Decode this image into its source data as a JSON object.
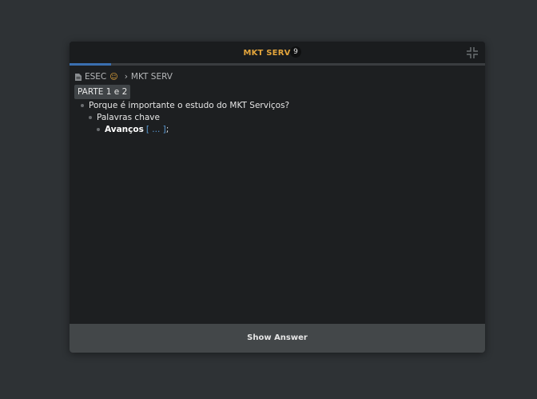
{
  "window": {
    "title": "MKT SERV",
    "count": "9",
    "progress": 0.1
  },
  "breadcrumb": {
    "root": "ESEC",
    "separator": "›",
    "current": "MKT SERV"
  },
  "tag": "PARTE 1 e 2",
  "outline": {
    "question": "Porque é importante o estudo do MKT Serviços?",
    "sub": "Palavras chave",
    "item_label": "Avanços",
    "cloze": "[ ... ]",
    "tail": ";"
  },
  "answer_button": "Show Answer",
  "colors": {
    "title_accent": "#e3a53c",
    "progress": "#3a6fb0",
    "cloze": "#5b9bd5"
  },
  "icons": [
    "document-icon",
    "smile-icon",
    "collapse-icon"
  ]
}
